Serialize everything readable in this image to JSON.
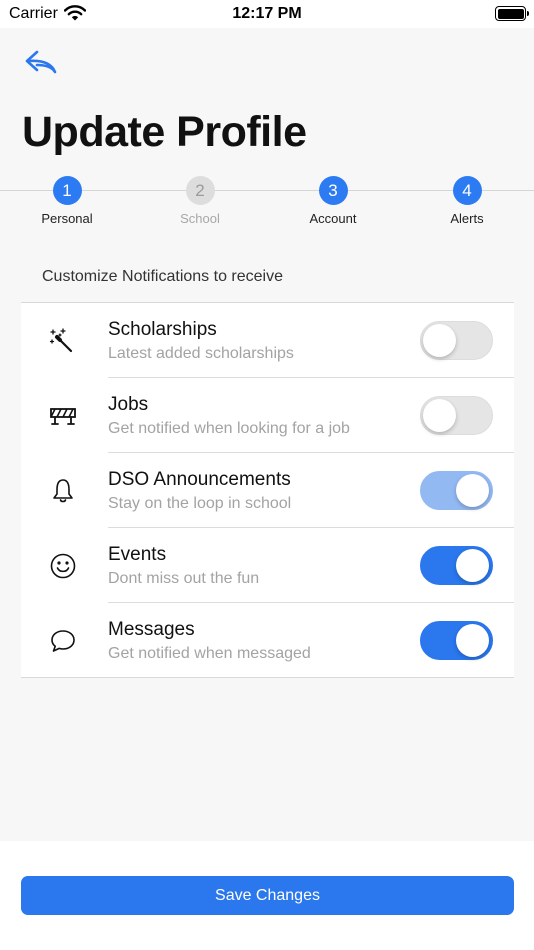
{
  "status_bar": {
    "carrier": "Carrier",
    "time": "12:17 PM"
  },
  "header": {
    "back_icon": "back-arrow-icon",
    "title": "Update Profile"
  },
  "stepper": {
    "steps": [
      {
        "number": "1",
        "label": "Personal",
        "active": true
      },
      {
        "number": "2",
        "label": "School",
        "active": false
      },
      {
        "number": "3",
        "label": "Account",
        "active": true
      },
      {
        "number": "4",
        "label": "Alerts",
        "active": true
      }
    ]
  },
  "notifications": {
    "section_title": "Customize Notifications to receive",
    "items": [
      {
        "icon": "magic-wand-icon",
        "title": "Scholarships",
        "subtitle": "Latest added scholarships",
        "enabled": false
      },
      {
        "icon": "barrier-icon",
        "title": "Jobs",
        "subtitle": "Get notified when looking for a job",
        "enabled": false
      },
      {
        "icon": "bell-icon",
        "title": "DSO Announcements",
        "subtitle": "Stay on the loop in school",
        "enabled": true,
        "disabled_state": true
      },
      {
        "icon": "smiley-icon",
        "title": "Events",
        "subtitle": "Dont miss out the fun",
        "enabled": true
      },
      {
        "icon": "chat-bubble-icon",
        "title": "Messages",
        "subtitle": "Get notified when messaged",
        "enabled": true
      }
    ]
  },
  "footer": {
    "save_label": "Save Changes"
  },
  "colors": {
    "accent": "#2a77ee",
    "accent_dim": "#93b9f2",
    "toggle_off": "#e5e5e5",
    "subtitle": "#a3a3a3"
  }
}
